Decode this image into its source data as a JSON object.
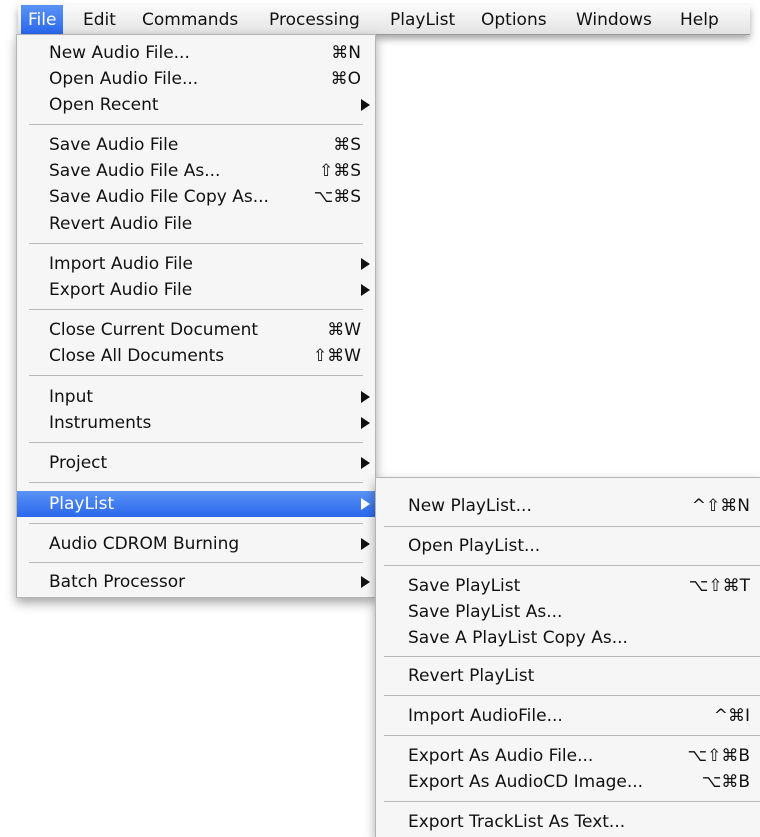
{
  "menubar": {
    "items": [
      "File",
      "Edit",
      "Commands",
      "Processing",
      "PlayList",
      "Options",
      "Windows",
      "Help"
    ],
    "active": "File"
  },
  "file_menu": {
    "items": [
      {
        "label": "New Audio File...",
        "shortcut": "⌘N"
      },
      {
        "label": "Open Audio File...",
        "shortcut": "⌘O"
      },
      {
        "label": "Open Recent",
        "submenu": true
      },
      {
        "label": "Save Audio File",
        "shortcut": "⌘S"
      },
      {
        "label": "Save Audio File As...",
        "shortcut": "⇧⌘S"
      },
      {
        "label": "Save Audio File Copy As...",
        "shortcut": "⌥⌘S"
      },
      {
        "label": "Revert Audio File"
      },
      {
        "label": "Import Audio File",
        "submenu": true
      },
      {
        "label": "Export Audio File",
        "submenu": true
      },
      {
        "label": "Close Current Document",
        "shortcut": "⌘W"
      },
      {
        "label": "Close All Documents",
        "shortcut": "⇧⌘W"
      },
      {
        "label": "Input",
        "submenu": true
      },
      {
        "label": "Instruments",
        "submenu": true
      },
      {
        "label": "Project",
        "submenu": true
      },
      {
        "label": "PlayList",
        "submenu": true,
        "highlighted": true
      },
      {
        "label": "Audio CDROM Burning",
        "submenu": true
      },
      {
        "label": "Batch Processor",
        "submenu": true
      }
    ]
  },
  "playlist_menu": {
    "items": [
      {
        "label": "New PlayList...",
        "shortcut": "^⇧⌘N"
      },
      {
        "label": "Open PlayList..."
      },
      {
        "label": "Save PlayList",
        "shortcut": "⌥⇧⌘T"
      },
      {
        "label": "Save PlayList As..."
      },
      {
        "label": "Save A PlayList Copy As..."
      },
      {
        "label": "Revert PlayList"
      },
      {
        "label": "Import AudioFile...",
        "shortcut": "^⌘I"
      },
      {
        "label": "Export As Audio File...",
        "shortcut": "⌥⇧⌘B"
      },
      {
        "label": "Export As AudioCD Image...",
        "shortcut": "⌥⌘B"
      },
      {
        "label": "Export TrackList As Text..."
      }
    ]
  },
  "colors": {
    "highlight": "#3a78ef",
    "menu_bg": "#f6f6f6",
    "separator": "#b9b9b9"
  }
}
